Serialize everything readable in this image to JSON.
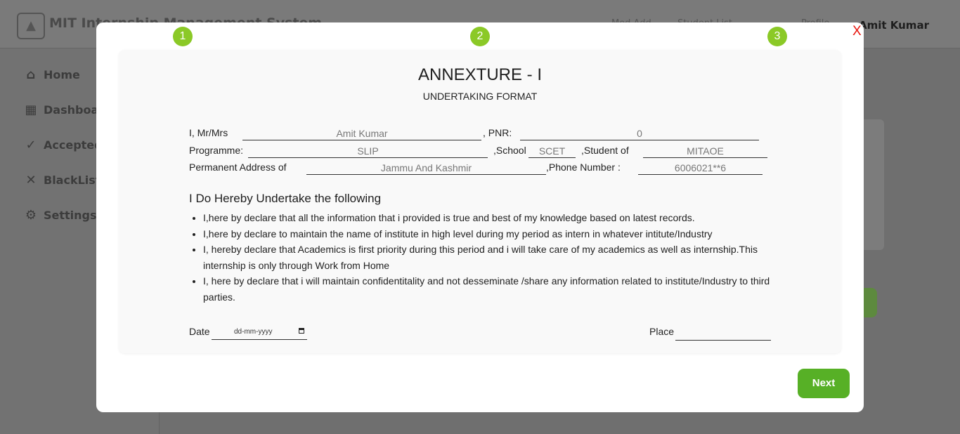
{
  "app": {
    "title": "MIT Internship Management System",
    "header_links": [
      "Mod Add",
      "Student List",
      "Profile"
    ],
    "user_name": "Amit Kumar"
  },
  "sidebar": {
    "items": [
      {
        "label": "Home",
        "icon": "home-icon"
      },
      {
        "label": "Dashboard",
        "icon": "grid-icon"
      },
      {
        "label": "Accepted",
        "icon": "check-icon"
      },
      {
        "label": "BlackList",
        "icon": "x-icon"
      },
      {
        "label": "Settings",
        "icon": "gear-icon"
      }
    ]
  },
  "modal": {
    "close_label": "X",
    "steps": [
      "1",
      "2",
      "3"
    ],
    "step_color": "#8bc927",
    "title": "ANNEXTURE - I",
    "subtitle": "UNDERTAKING FORMAT",
    "form": {
      "name_label": "I,  Mr/Mrs",
      "name_value": "Amit Kumar",
      "pnr_label": ",  PNR:",
      "pnr_value": "0",
      "programme_label": "Programme:",
      "programme_value": "SLIP",
      "school_label": ",School",
      "school_value": "SCET",
      "student_of_label": ",Student  of",
      "student_of_value": "MITAOE",
      "address_label": "Permanent  Address  of",
      "address_value": "Jammu And Kashmir",
      "phone_label": ",Phone  Number  :",
      "phone_value": "6006021**6"
    },
    "undertake_heading": "I Do Hereby Undertake the following",
    "declarations": [
      "I,here by declare that all the information that i provided is true and best of my knowledge based on latest records.",
      "I,here by declare to maintain the name of institute in high level during my period as intern in whatever intitute/Industry",
      "I, hereby declare that Academics is first priority during this period and i will take care of my academics as well as internship.This internship is only through Work from Home",
      "I, here by declare that i will maintain confidentitality and not desseminate /share any information related to institute/Industry to third parties."
    ],
    "date_label": "Date",
    "date_placeholder": "dd-mm-yyyy",
    "place_label": "Place",
    "place_value": "",
    "next_label": "Next",
    "next_color": "#57b026"
  }
}
